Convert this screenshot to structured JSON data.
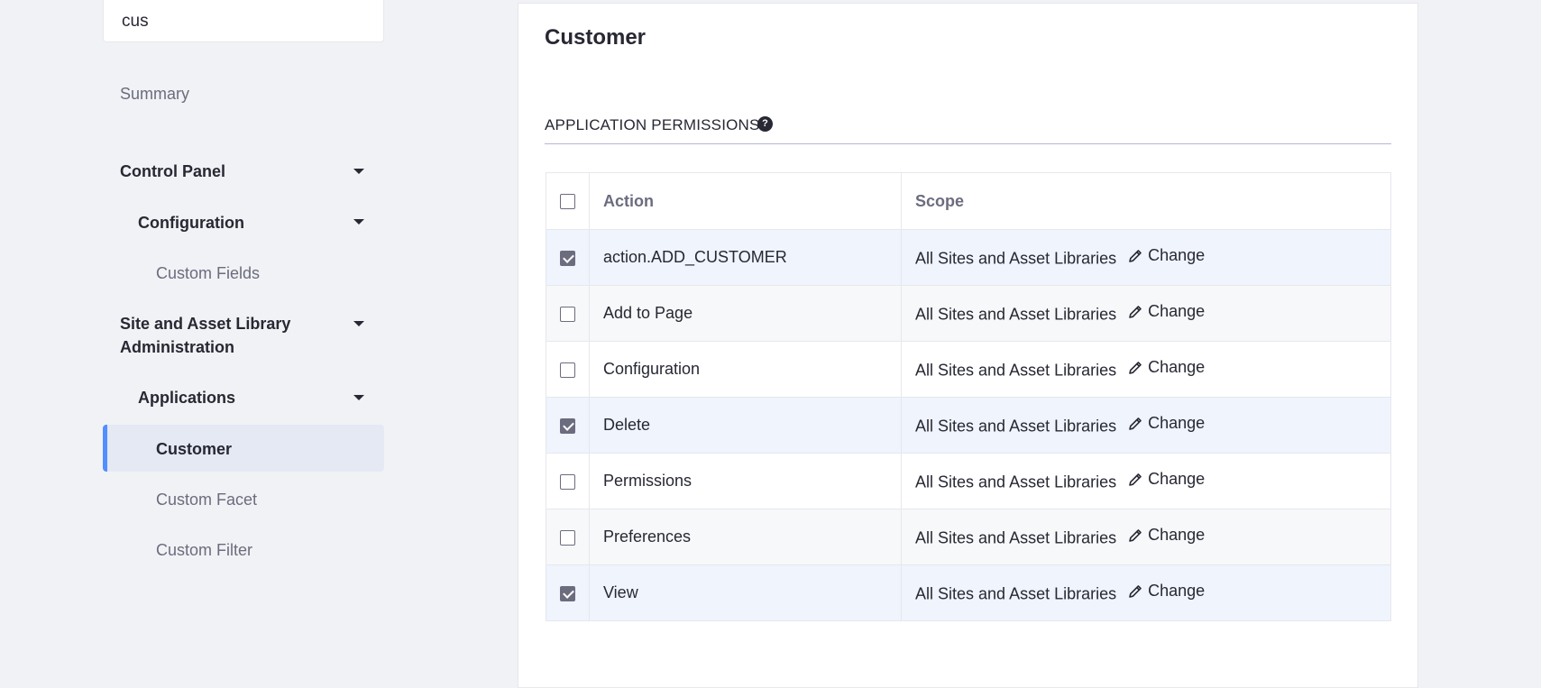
{
  "search": {
    "value": "cus"
  },
  "sidebar": {
    "summary": "Summary",
    "control_panel": "Control Panel",
    "configuration": "Configuration",
    "custom_fields": "Custom Fields",
    "site_admin_line1": "Site and Asset Library",
    "site_admin_line2": "Administration",
    "applications": "Applications",
    "customer": "Customer",
    "custom_facet": "Custom Facet",
    "custom_filter": "Custom Filter"
  },
  "main": {
    "title": "Customer",
    "section_title": "APPLICATION PERMISSIONS",
    "help_glyph": "?",
    "columns": {
      "action": "Action",
      "scope": "Scope"
    },
    "rows": [
      {
        "action": "action.ADD_CUSTOMER",
        "scope": "All Sites and Asset Libraries",
        "change": "Change",
        "checked": true
      },
      {
        "action": "Add to Page",
        "scope": "All Sites and Asset Libraries",
        "change": "Change",
        "checked": false
      },
      {
        "action": "Configuration",
        "scope": "All Sites and Asset Libraries",
        "change": "Change",
        "checked": false
      },
      {
        "action": "Delete",
        "scope": "All Sites and Asset Libraries",
        "change": "Change",
        "checked": true
      },
      {
        "action": "Permissions",
        "scope": "All Sites and Asset Libraries",
        "change": "Change",
        "checked": false
      },
      {
        "action": "Preferences",
        "scope": "All Sites and Asset Libraries",
        "change": "Change",
        "checked": false
      },
      {
        "action": "View",
        "scope": "All Sites and Asset Libraries",
        "change": "Change",
        "checked": true
      }
    ]
  },
  "colors": {
    "accent": "#528eff",
    "active_bg": "#e4e9f4",
    "checked_row_bg": "#eff4fd"
  },
  "icons": {
    "help": "question-circle-icon",
    "change": "pencil-icon",
    "expand": "caret-down-icon"
  }
}
